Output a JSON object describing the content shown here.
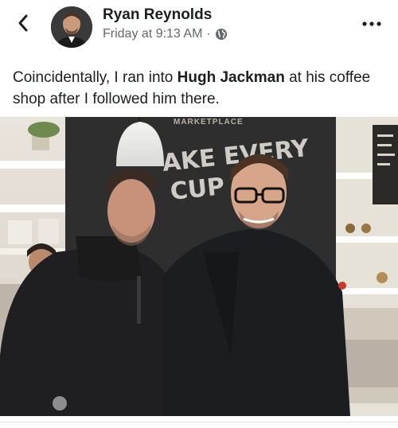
{
  "post": {
    "author": "Ryan Reynolds",
    "timestamp": "Friday at 9:13 AM",
    "separator": "·",
    "privacy_icon": "globe-icon",
    "caption_part1": "Coincidentally, I ran into ",
    "caption_bold": "Hugh Jackman",
    "caption_part2": " at his coffee shop after I followed him there."
  },
  "photo_sign": {
    "top": "MARKETPLACE",
    "line1": "AKE EVERY",
    "line2": "CUP C"
  },
  "icons": {
    "back": "chevron-left-icon",
    "more": "more-horizontal-icon",
    "privacy": "globe-icon"
  }
}
